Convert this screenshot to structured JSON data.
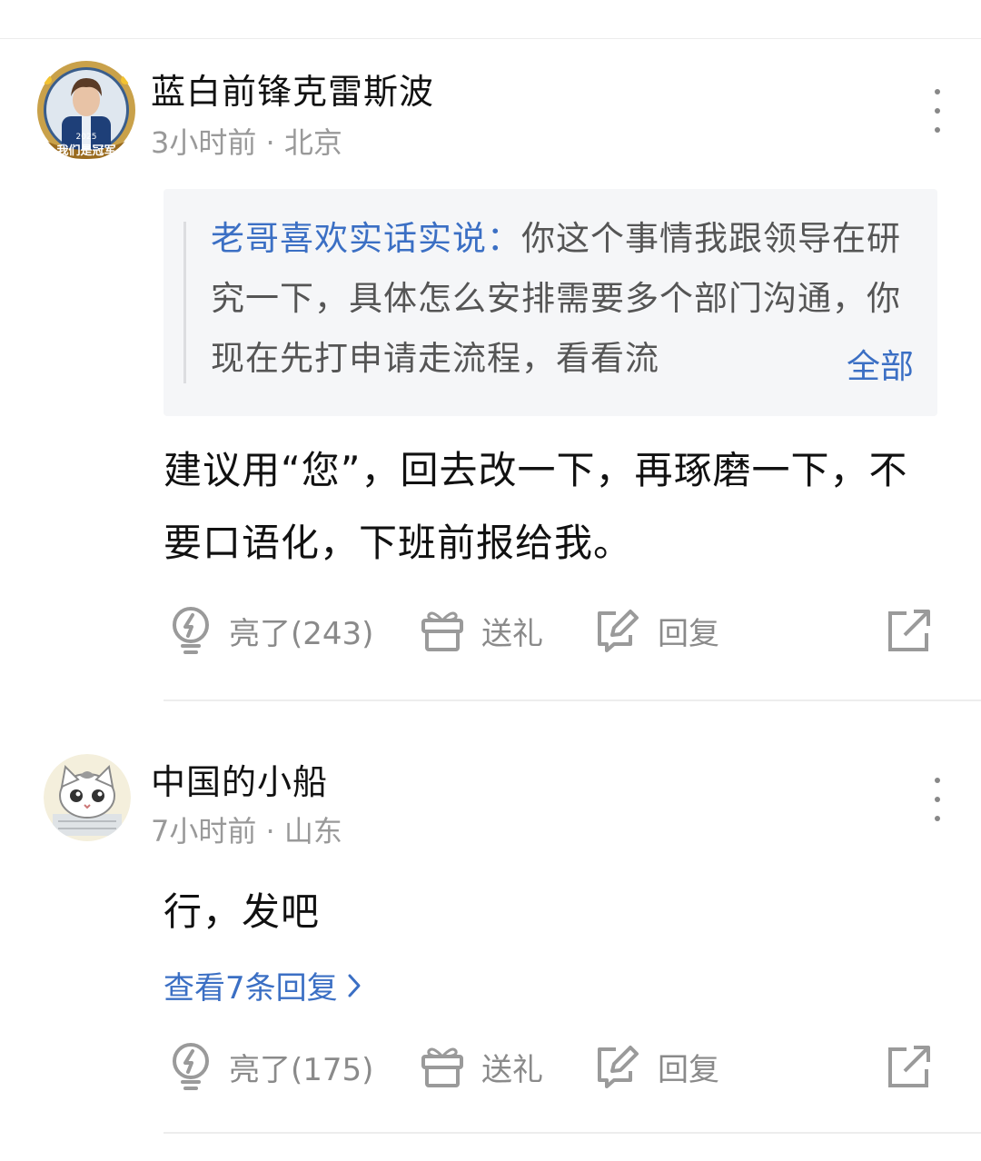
{
  "comments": [
    {
      "username": "蓝白前锋克雷斯波",
      "meta": "3小时前 · 北京",
      "avatar_badge": "我们是冠军",
      "avatar_year": "2025",
      "quote": {
        "author": "老哥喜欢实话实说：",
        "text": "你这个事情我跟领导在研究一下，具体怎么安排需要多个部门沟通，你现在先打申请走流程，看看流",
        "more_label": "全部"
      },
      "body": "建议用“您”，回去改一下，再琢磨一下，不要口语化，下班前报给我。",
      "actions": {
        "like_label": "亮了(243)",
        "gift_label": "送礼",
        "reply_label": "回复"
      }
    },
    {
      "username": "中国的小船",
      "meta": "7小时前 · 山东",
      "body": "行，发吧",
      "view_replies": "查看7条回复",
      "actions": {
        "like_label": "亮了(175)",
        "gift_label": "送礼",
        "reply_label": "回复"
      }
    }
  ],
  "icons": {
    "like": "lightbulb-icon",
    "gift": "gift-icon",
    "reply": "edit-icon",
    "share": "share-icon",
    "more": "more-vertical-icon",
    "chevron": "chevron-right-icon"
  },
  "colors": {
    "link_blue": "#3b6fc4",
    "meta_gray": "#999999",
    "quote_bg": "#f5f6f8"
  }
}
